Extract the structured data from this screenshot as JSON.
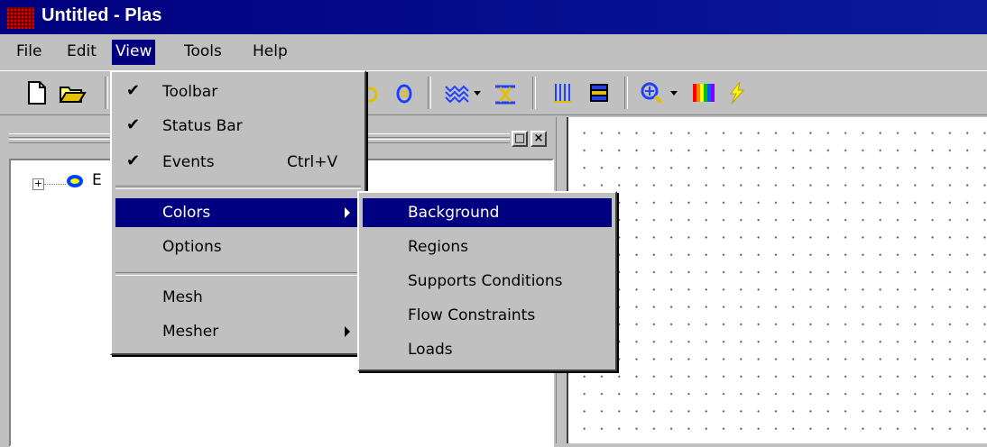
{
  "window": {
    "title": "Untitled - Plas",
    "app_icon": "plas-app-icon"
  },
  "menubar": {
    "items": [
      {
        "label": "File",
        "mnemonic": "F"
      },
      {
        "label": "Edit",
        "mnemonic": "E"
      },
      {
        "label": "View",
        "mnemonic": "V",
        "active": true
      },
      {
        "label": "Tools",
        "mnemonic": "T"
      },
      {
        "label": "Help",
        "mnemonic": "H"
      }
    ]
  },
  "toolbar": {
    "buttons": [
      "new-document-icon",
      "open-folder-icon",
      "circle-icon",
      "ellipse-icon",
      "wave-pattern-icon",
      "clamp-icon",
      "vertical-lines-icon",
      "layers-icon",
      "zoom-icon",
      "color-spectrum-icon",
      "lightning-icon"
    ]
  },
  "tree": {
    "expand_symbol": "+",
    "root_label": "E"
  },
  "left_pane": {
    "restore_symbol": "□",
    "close_symbol": "×"
  },
  "view_menu": {
    "items": [
      {
        "label": "Toolbar",
        "checked": true
      },
      {
        "label": "Status Bar",
        "checked": true
      },
      {
        "label": "Events",
        "checked": true,
        "shortcut": "Ctrl+V"
      },
      {
        "label": "Colors",
        "submenu": true,
        "highlighted": true
      },
      {
        "label": "Options"
      },
      {
        "label": "Mesh"
      },
      {
        "label": "Mesher",
        "submenu": true
      }
    ],
    "check_mark": "✔"
  },
  "colors_submenu": {
    "items": [
      {
        "label": "Background",
        "highlighted": true
      },
      {
        "label": "Regions"
      },
      {
        "label": "Supports Conditions"
      },
      {
        "label": "Flow Constraints"
      },
      {
        "label": "Loads"
      }
    ]
  },
  "colors": {
    "title_bar": "#000080",
    "menu_highlight": "#000080",
    "face": "#c0c0c0"
  }
}
